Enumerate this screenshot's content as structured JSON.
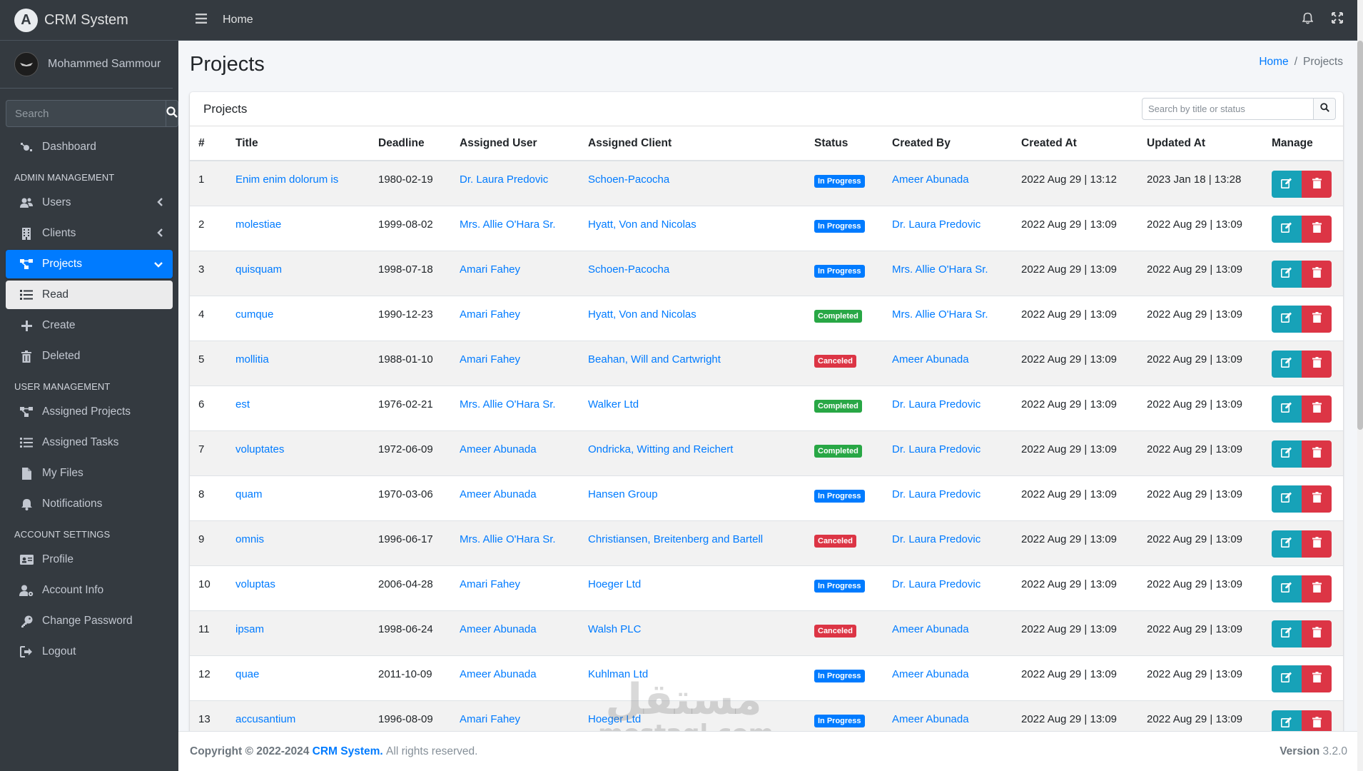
{
  "app": {
    "title": "CRM System",
    "logo_letter": "A"
  },
  "user": {
    "name": "Mohammed Sammour"
  },
  "sidebar": {
    "search_placeholder": "Search",
    "dashboard": "Dashboard",
    "admin_header": "ADMIN MANAGEMENT",
    "users": "Users",
    "clients": "Clients",
    "projects": "Projects",
    "read": "Read",
    "create": "Create",
    "deleted": "Deleted",
    "user_header": "USER MANAGEMENT",
    "assigned_projects": "Assigned Projects",
    "assigned_tasks": "Assigned Tasks",
    "my_files": "My Files",
    "notifications": "Notifications",
    "account_header": "ACCOUNT SETTINGS",
    "profile": "Profile",
    "account_info": "Account Info",
    "change_password": "Change Password",
    "logout": "Logout"
  },
  "topbar": {
    "home": "Home"
  },
  "page": {
    "title": "Projects",
    "breadcrumb_home": "Home",
    "breadcrumb_sep": "/",
    "breadcrumb_current": "Projects"
  },
  "card": {
    "title": "Projects",
    "search_placeholder": "Search by title or status"
  },
  "table": {
    "headers": [
      "#",
      "Title",
      "Deadline",
      "Assigned User",
      "Assigned Client",
      "Status",
      "Created By",
      "Created At",
      "Updated At",
      "Manage"
    ],
    "rows": [
      {
        "num": "1",
        "title": "Enim enim dolorum is",
        "deadline": "1980-02-19",
        "user": "Dr. Laura Predovic",
        "client": "Schoen-Pacocha",
        "status": "In Progress",
        "status_type": "prog",
        "created_by": "Ameer Abunada",
        "created_at": "2022 Aug 29 | 13:12",
        "updated_at": "2023 Jan 18 | 13:28"
      },
      {
        "num": "2",
        "title": "molestiae",
        "deadline": "1999-08-02",
        "user": "Mrs. Allie O'Hara Sr.",
        "client": "Hyatt, Von and Nicolas",
        "status": "In Progress",
        "status_type": "prog",
        "created_by": "Dr. Laura Predovic",
        "created_at": "2022 Aug 29 | 13:09",
        "updated_at": "2022 Aug 29 | 13:09"
      },
      {
        "num": "3",
        "title": "quisquam",
        "deadline": "1998-07-18",
        "user": "Amari Fahey",
        "client": "Schoen-Pacocha",
        "status": "In Progress",
        "status_type": "prog",
        "created_by": "Mrs. Allie O'Hara Sr.",
        "created_at": "2022 Aug 29 | 13:09",
        "updated_at": "2022 Aug 29 | 13:09"
      },
      {
        "num": "4",
        "title": "cumque",
        "deadline": "1990-12-23",
        "user": "Amari Fahey",
        "client": "Hyatt, Von and Nicolas",
        "status": "Completed",
        "status_type": "comp",
        "created_by": "Mrs. Allie O'Hara Sr.",
        "created_at": "2022 Aug 29 | 13:09",
        "updated_at": "2022 Aug 29 | 13:09"
      },
      {
        "num": "5",
        "title": "mollitia",
        "deadline": "1988-01-10",
        "user": "Amari Fahey",
        "client": "Beahan, Will and Cartwright",
        "status": "Canceled",
        "status_type": "canc",
        "created_by": "Ameer Abunada",
        "created_at": "2022 Aug 29 | 13:09",
        "updated_at": "2022 Aug 29 | 13:09"
      },
      {
        "num": "6",
        "title": "est",
        "deadline": "1976-02-21",
        "user": "Mrs. Allie O'Hara Sr.",
        "client": "Walker Ltd",
        "status": "Completed",
        "status_type": "comp",
        "created_by": "Dr. Laura Predovic",
        "created_at": "2022 Aug 29 | 13:09",
        "updated_at": "2022 Aug 29 | 13:09"
      },
      {
        "num": "7",
        "title": "voluptates",
        "deadline": "1972-06-09",
        "user": "Ameer Abunada",
        "client": "Ondricka, Witting and Reichert",
        "status": "Completed",
        "status_type": "comp",
        "created_by": "Dr. Laura Predovic",
        "created_at": "2022 Aug 29 | 13:09",
        "updated_at": "2022 Aug 29 | 13:09"
      },
      {
        "num": "8",
        "title": "quam",
        "deadline": "1970-03-06",
        "user": "Ameer Abunada",
        "client": "Hansen Group",
        "status": "In Progress",
        "status_type": "prog",
        "created_by": "Dr. Laura Predovic",
        "created_at": "2022 Aug 29 | 13:09",
        "updated_at": "2022 Aug 29 | 13:09"
      },
      {
        "num": "9",
        "title": "omnis",
        "deadline": "1996-06-17",
        "user": "Mrs. Allie O'Hara Sr.",
        "client": "Christiansen, Breitenberg and Bartell",
        "status": "Canceled",
        "status_type": "canc",
        "created_by": "Dr. Laura Predovic",
        "created_at": "2022 Aug 29 | 13:09",
        "updated_at": "2022 Aug 29 | 13:09"
      },
      {
        "num": "10",
        "title": "voluptas",
        "deadline": "2006-04-28",
        "user": "Amari Fahey",
        "client": "Hoeger Ltd",
        "status": "In Progress",
        "status_type": "prog",
        "created_by": "Dr. Laura Predovic",
        "created_at": "2022 Aug 29 | 13:09",
        "updated_at": "2022 Aug 29 | 13:09"
      },
      {
        "num": "11",
        "title": "ipsam",
        "deadline": "1998-06-24",
        "user": "Ameer Abunada",
        "client": "Walsh PLC",
        "status": "Canceled",
        "status_type": "canc",
        "created_by": "Ameer Abunada",
        "created_at": "2022 Aug 29 | 13:09",
        "updated_at": "2022 Aug 29 | 13:09"
      },
      {
        "num": "12",
        "title": "quae",
        "deadline": "2011-10-09",
        "user": "Ameer Abunada",
        "client": "Kuhlman Ltd",
        "status": "In Progress",
        "status_type": "prog",
        "created_by": "Ameer Abunada",
        "created_at": "2022 Aug 29 | 13:09",
        "updated_at": "2022 Aug 29 | 13:09"
      },
      {
        "num": "13",
        "title": "accusantium",
        "deadline": "1996-08-09",
        "user": "Amari Fahey",
        "client": "Hoeger Ltd",
        "status": "In Progress",
        "status_type": "prog",
        "created_by": "Ameer Abunada",
        "created_at": "2022 Aug 29 | 13:09",
        "updated_at": "2022 Aug 29 | 13:09"
      }
    ]
  },
  "footer": {
    "copyright": "Copyright © 2022-2024",
    "brand": "CRM System.",
    "rights": "All rights reserved.",
    "version_label": "Version",
    "version_num": "3.2.0"
  },
  "watermark": {
    "arabic": "مستقل",
    "latin": "mostaql.com"
  },
  "colors": {
    "primary": "#007bff",
    "info": "#17a2b8",
    "danger": "#dc3545",
    "success": "#28a745",
    "sidebar": "#343a40"
  }
}
